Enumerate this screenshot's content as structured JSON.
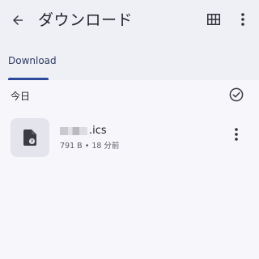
{
  "topbar": {
    "title": "ダウンロード",
    "back_icon": "arrow-back-icon",
    "grid_icon": "grid-view-icon",
    "more_icon": "more-vert-icon"
  },
  "tabs": [
    {
      "label": "Download",
      "selected": true
    }
  ],
  "section": {
    "title": "今日",
    "select_icon": "check-circle-icon"
  },
  "items": [
    {
      "file_name": ".ics",
      "name_redacted": true,
      "meta": "791 B • 18 分前",
      "thumb_icon": "unknown-file-icon"
    }
  ],
  "colors": {
    "background": "#f7f6fb",
    "appbar": "#eef0f6",
    "accent": "#2e4a9a",
    "text": "#1f1f24",
    "secondary_text": "#5d5d66"
  }
}
